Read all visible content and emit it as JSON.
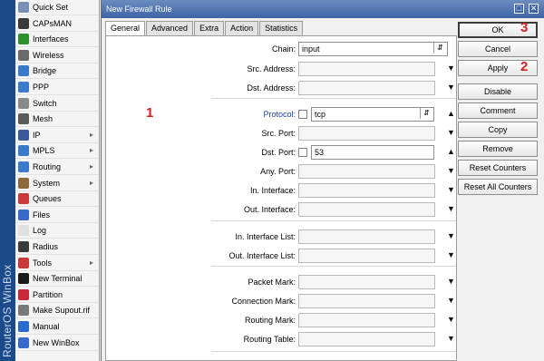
{
  "brand": "RouterOS WinBox",
  "sidebar": {
    "items": [
      {
        "label": "Quick Set",
        "icon": "quick-set-icon",
        "color": "#7a8fb8",
        "arrow": false
      },
      {
        "label": "CAPsMAN",
        "icon": "capsman-icon",
        "color": "#3a3a3a",
        "arrow": false
      },
      {
        "label": "Interfaces",
        "icon": "interfaces-icon",
        "color": "#2f8f2f",
        "arrow": false
      },
      {
        "label": "Wireless",
        "icon": "wireless-icon",
        "color": "#6a6a6a",
        "arrow": false
      },
      {
        "label": "Bridge",
        "icon": "bridge-icon",
        "color": "#3a7ac8",
        "arrow": false
      },
      {
        "label": "PPP",
        "icon": "ppp-icon",
        "color": "#3a7ac8",
        "arrow": false
      },
      {
        "label": "Switch",
        "icon": "switch-icon",
        "color": "#8a8a8a",
        "arrow": false
      },
      {
        "label": "Mesh",
        "icon": "mesh-icon",
        "color": "#5a5a5a",
        "arrow": false
      },
      {
        "label": "IP",
        "icon": "ip-icon",
        "color": "#3a5a9a",
        "arrow": true
      },
      {
        "label": "MPLS",
        "icon": "mpls-icon",
        "color": "#3a7ac8",
        "arrow": true
      },
      {
        "label": "Routing",
        "icon": "routing-icon",
        "color": "#3a7ac8",
        "arrow": true
      },
      {
        "label": "System",
        "icon": "system-icon",
        "color": "#8a6a3a",
        "arrow": true
      },
      {
        "label": "Queues",
        "icon": "queues-icon",
        "color": "#c83a3a",
        "arrow": false
      },
      {
        "label": "Files",
        "icon": "files-icon",
        "color": "#3a6ac8",
        "arrow": false
      },
      {
        "label": "Log",
        "icon": "log-icon",
        "color": "#e0e0e0",
        "arrow": false
      },
      {
        "label": "Radius",
        "icon": "radius-icon",
        "color": "#3a3a3a",
        "arrow": false
      },
      {
        "label": "Tools",
        "icon": "tools-icon",
        "color": "#c83a3a",
        "arrow": true
      },
      {
        "label": "New Terminal",
        "icon": "terminal-icon",
        "color": "#1a1a1a",
        "arrow": false
      },
      {
        "label": "Partition",
        "icon": "partition-icon",
        "color": "#c8283a",
        "arrow": false
      },
      {
        "label": "Make Supout.rif",
        "icon": "supout-icon",
        "color": "#7a7a7a",
        "arrow": false
      },
      {
        "label": "Manual",
        "icon": "manual-icon",
        "color": "#2a6ac8",
        "arrow": false
      },
      {
        "label": "New WinBox",
        "icon": "winbox-icon",
        "color": "#3a6ac8",
        "arrow": false
      }
    ]
  },
  "window": {
    "title": "New Firewall Rule",
    "restore_glyph": "□",
    "close_glyph": "✕"
  },
  "tabs": [
    {
      "label": "General",
      "active": true
    },
    {
      "label": "Advanced",
      "active": false
    },
    {
      "label": "Extra",
      "active": false
    },
    {
      "label": "Action",
      "active": false
    },
    {
      "label": "Statistics",
      "active": false
    }
  ],
  "form": {
    "rows": [
      {
        "label": "Chain:",
        "value": "input",
        "blue": false,
        "checkbox": false,
        "combo": true,
        "tri": "",
        "empty": false
      },
      {
        "label": "Src. Address:",
        "value": "",
        "blue": false,
        "checkbox": false,
        "combo": false,
        "tri": "▼",
        "empty": true
      },
      {
        "label": "Dst. Address:",
        "value": "",
        "blue": false,
        "checkbox": false,
        "combo": false,
        "tri": "▼",
        "empty": true
      },
      {
        "label": "Protocol:",
        "value": "tcp",
        "blue": true,
        "checkbox": true,
        "combo": true,
        "tri": "▲",
        "empty": false
      },
      {
        "label": "Src. Port:",
        "value": "",
        "blue": false,
        "checkbox": false,
        "combo": false,
        "tri": "▼",
        "empty": true
      },
      {
        "label": "Dst. Port:",
        "value": "53",
        "blue": false,
        "checkbox": true,
        "combo": false,
        "tri": "▲",
        "empty": false
      },
      {
        "label": "Any. Port:",
        "value": "",
        "blue": false,
        "checkbox": false,
        "combo": false,
        "tri": "▼",
        "empty": true
      },
      {
        "label": "In. Interface:",
        "value": "",
        "blue": false,
        "checkbox": false,
        "combo": false,
        "tri": "▼",
        "empty": true
      },
      {
        "label": "Out. Interface:",
        "value": "",
        "blue": false,
        "checkbox": false,
        "combo": false,
        "tri": "▼",
        "empty": true
      },
      {
        "label": "In. Interface List:",
        "value": "",
        "blue": false,
        "checkbox": false,
        "combo": false,
        "tri": "▼",
        "empty": true
      },
      {
        "label": "Out. Interface List:",
        "value": "",
        "blue": false,
        "checkbox": false,
        "combo": false,
        "tri": "▼",
        "empty": true
      },
      {
        "label": "Packet Mark:",
        "value": "",
        "blue": false,
        "checkbox": false,
        "combo": false,
        "tri": "▼",
        "empty": true
      },
      {
        "label": "Connection Mark:",
        "value": "",
        "blue": false,
        "checkbox": false,
        "combo": false,
        "tri": "▼",
        "empty": true
      },
      {
        "label": "Routing Mark:",
        "value": "",
        "blue": false,
        "checkbox": false,
        "combo": false,
        "tri": "▼",
        "empty": true
      },
      {
        "label": "Routing Table:",
        "value": "",
        "blue": false,
        "checkbox": false,
        "combo": false,
        "tri": "▼",
        "empty": true
      }
    ]
  },
  "buttons": [
    "OK",
    "Cancel",
    "Apply",
    "Disable",
    "Comment",
    "Copy",
    "Remove",
    "Reset Counters",
    "Reset All Counters"
  ],
  "annotations": {
    "protocol": "1",
    "apply": "2",
    "ok": "3"
  },
  "colors": {
    "accent_red": "#d42020",
    "title_blue": "#3e64a6",
    "link_blue": "#1a3fb0"
  }
}
